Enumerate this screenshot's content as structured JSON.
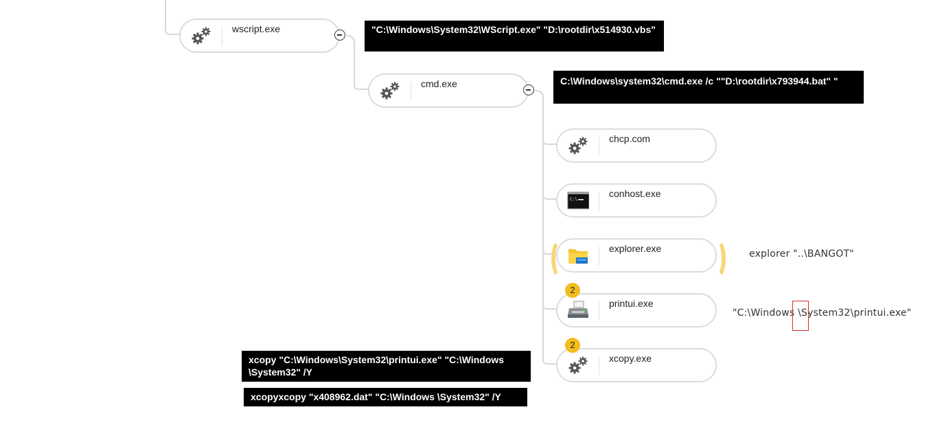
{
  "nodes": {
    "wscript": {
      "label": "wscript.exe",
      "icon": "gears-icon"
    },
    "cmd": {
      "label": "cmd.exe",
      "icon": "gears-icon"
    },
    "chcp": {
      "label": "chcp.com",
      "icon": "gears-icon"
    },
    "conhost": {
      "label": "conhost.exe",
      "icon": "console-icon"
    },
    "explorer": {
      "label": "explorer.exe",
      "icon": "folder-icon"
    },
    "printui": {
      "label": "printui.exe",
      "icon": "printer-icon",
      "badge": "2"
    },
    "xcopy": {
      "label": "xcopy.exe",
      "icon": "gears-icon",
      "badge": "2"
    }
  },
  "commands": {
    "wscript": "\"C:\\Windows\\System32\\WScript.exe\" \"D:\\rootdir\\x514930.vbs\"",
    "cmd": "C:\\Windows\\system32\\cmd.exe /c \"\"D:\\rootdir\\x793944.bat\" \"",
    "explorer": "explorer \"..\\BANGOT\"",
    "printui": "\"C:\\Windows \\System32\\printui.exe\"",
    "xcopy1": "xcopy \"C:\\Windows\\System32\\printui.exe\" \"C:\\Windows \\System32\" /Y",
    "xcopy2": "xcopyxcopy \"x408962.dat\" \"C:\\Windows \\System32\" /Y"
  },
  "colors": {
    "badge": "#f2bd1d",
    "highlight": "#f6d778",
    "command_box_bg": "#000000",
    "node_border": "#dcdcdc",
    "marker": "#d32f2f"
  }
}
